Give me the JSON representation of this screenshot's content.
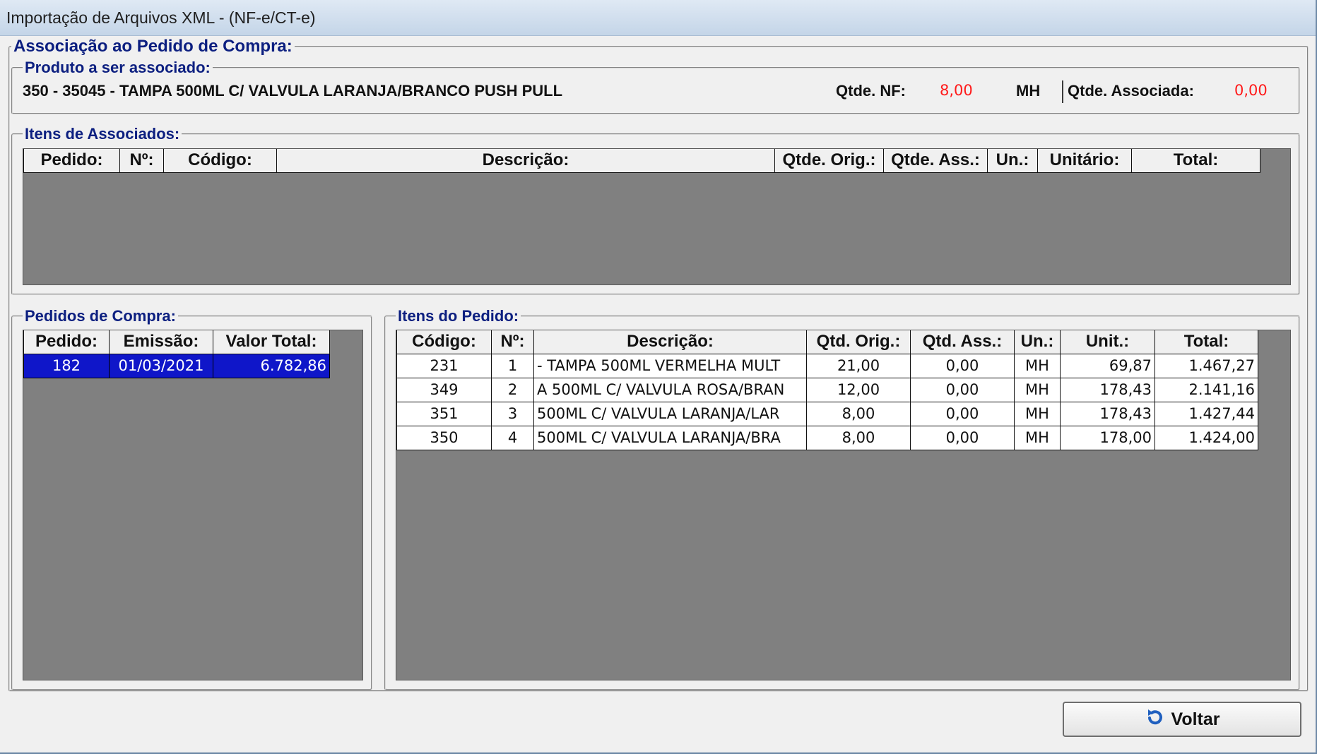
{
  "window": {
    "title": "Importação de Arquivos XML - (NF-e/CT-e)"
  },
  "main_group": {
    "legend": "Associação ao Pedido de Compra:"
  },
  "produto": {
    "legend": "Produto a ser associado:",
    "description": "350 - 35045 - TAMPA 500ML C/ VALVULA LARANJA/BRANCO PUSH PULL",
    "qtde_nf_label": "Qtde. NF:",
    "qtde_nf_value": "8,00",
    "unit": "MH",
    "qtde_associada_label": "Qtde. Associada:",
    "qtde_associada_value": "0,00"
  },
  "itens_associados": {
    "legend": "Itens de Associados:",
    "columns": [
      "Pedido:",
      "Nº:",
      "Código:",
      "Descrição:",
      "Qtde. Orig.:",
      "Qtde. Ass.:",
      "Un.:",
      "Unitário:",
      "Total:"
    ]
  },
  "pedidos": {
    "legend": "Pedidos de Compra:",
    "columns": [
      "Pedido:",
      "Emissão:",
      "Valor Total:"
    ],
    "rows": [
      [
        "182",
        "01/03/2021",
        "6.782,86"
      ]
    ]
  },
  "itens_pedido": {
    "legend": "Itens do Pedido:",
    "columns": [
      "Código:",
      "Nº:",
      "Descrição:",
      "Qtd. Orig.:",
      "Qtd. Ass.:",
      "Un.:",
      "Unit.:",
      "Total:"
    ],
    "rows": [
      [
        "231",
        "1",
        "- TAMPA 500ML VERMELHA MULT",
        "21,00",
        "0,00",
        "MH",
        "69,87",
        "1.467,27"
      ],
      [
        "349",
        "2",
        "A 500ML C/ VALVULA ROSA/BRAN",
        "12,00",
        "0,00",
        "MH",
        "178,43",
        "2.141,16"
      ],
      [
        "351",
        "3",
        "500ML C/ VALVULA LARANJA/LAR",
        "8,00",
        "0,00",
        "MH",
        "178,43",
        "1.427,44"
      ],
      [
        "350",
        "4",
        "500ML C/ VALVULA LARANJA/BRA",
        "8,00",
        "0,00",
        "MH",
        "178,00",
        "1.424,00"
      ]
    ]
  },
  "buttons": {
    "voltar": "Voltar",
    "voltar_icon": "return-arrow-icon"
  },
  "colors": {
    "legend": "#0c1f80",
    "value_red": "#ff1a1a",
    "selection": "#0f16c9",
    "grid_bg": "#808080"
  }
}
